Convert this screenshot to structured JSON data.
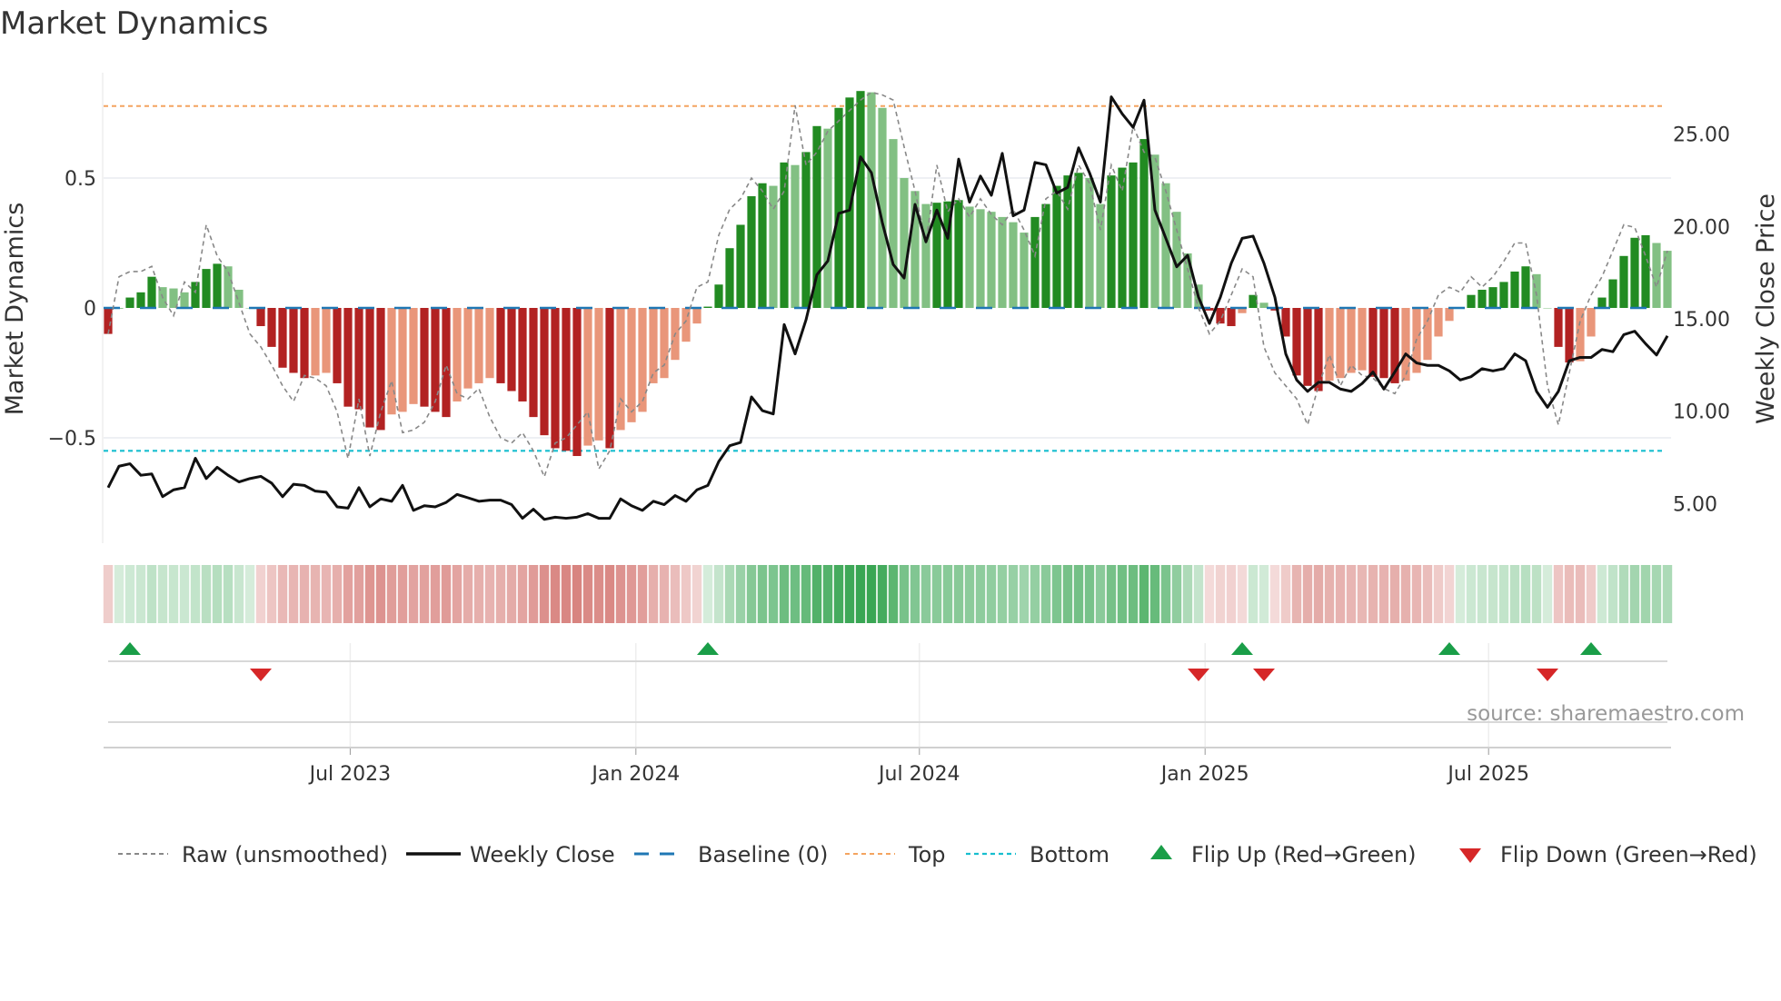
{
  "title": "Market Dynamics",
  "source": "source: sharemaestro.com",
  "colors": {
    "green_strong": "#228b22",
    "green_light": "#82c083",
    "red_strong": "#b22222",
    "red_light": "#e9967a",
    "close": "#111111",
    "raw": "#888888",
    "baseline": "#1f77b4",
    "top": "#f4a460",
    "bottom": "#17becf",
    "flip_up": "#1a9e48",
    "flip_down": "#d62728"
  },
  "chart_data": {
    "type": "bar",
    "title": "Market Dynamics",
    "ylabel": "Market Dynamics",
    "y2label": "Weekly Close Price",
    "ylim": [
      -0.93,
      0.9
    ],
    "y2lim": [
      1.5,
      28.5
    ],
    "yticks": [
      {
        "v": 0.5,
        "label": "0.5"
      },
      {
        "v": 0,
        "label": "0"
      },
      {
        "v": -0.5,
        "label": "−0.5"
      }
    ],
    "y2ticks": [
      {
        "v": 25,
        "label": "25.00"
      },
      {
        "v": 20,
        "label": "20.00"
      },
      {
        "v": 15,
        "label": "15.00"
      },
      {
        "v": 10,
        "label": "10.00"
      },
      {
        "v": 5,
        "label": "5.00"
      }
    ],
    "xticks": [
      {
        "i": 22.2,
        "label": "Jul 2023"
      },
      {
        "i": 48.4,
        "label": "Jan 2024"
      },
      {
        "i": 74.4,
        "label": "Jul 2024"
      },
      {
        "i": 100.6,
        "label": "Jan 2025"
      },
      {
        "i": 126.6,
        "label": "Jul 2025"
      }
    ],
    "top_level": 0.777,
    "bottom_level": -0.55,
    "momentum": [
      -0.1,
      0,
      0.04,
      0.06,
      0.12,
      0.08,
      0.075,
      0.06,
      0.1,
      0.15,
      0.17,
      0.16,
      0.07,
      0,
      -0.07,
      -0.15,
      -0.23,
      -0.25,
      -0.27,
      -0.26,
      -0.25,
      -0.29,
      -0.38,
      -0.39,
      -0.46,
      -0.47,
      -0.41,
      -0.4,
      -0.37,
      -0.38,
      -0.4,
      -0.42,
      -0.36,
      -0.31,
      -0.29,
      -0.27,
      -0.29,
      -0.32,
      -0.36,
      -0.42,
      -0.49,
      -0.54,
      -0.55,
      -0.57,
      -0.53,
      -0.51,
      -0.54,
      -0.47,
      -0.44,
      -0.4,
      -0.29,
      -0.27,
      -0.2,
      -0.13,
      -0.06,
      0.005,
      0.09,
      0.23,
      0.32,
      0.43,
      0.48,
      0.47,
      0.56,
      0.55,
      0.6,
      0.7,
      0.69,
      0.77,
      0.81,
      0.835,
      0.83,
      0.77,
      0.65,
      0.5,
      0.45,
      0.4,
      0.405,
      0.41,
      0.415,
      0.39,
      0.38,
      0.37,
      0.35,
      0.33,
      0.29,
      0.35,
      0.4,
      0.47,
      0.51,
      0.52,
      0.5,
      0.4,
      0.51,
      0.54,
      0.56,
      0.65,
      0.59,
      0.48,
      0.37,
      0.21,
      0.09,
      -0.01,
      -0.06,
      -0.07,
      -0.02,
      0.05,
      0.02,
      -0.01,
      -0.11,
      -0.26,
      -0.3,
      -0.32,
      -0.28,
      -0.27,
      -0.25,
      -0.24,
      -0.265,
      -0.27,
      -0.29,
      -0.28,
      -0.25,
      -0.2,
      -0.11,
      -0.05,
      0,
      0.05,
      0.07,
      0.08,
      0.1,
      0.14,
      0.16,
      0.13,
      0,
      -0.15,
      -0.21,
      -0.205,
      -0.11,
      0.04,
      0.11,
      0.2,
      0.27,
      0.28,
      0.25,
      0.22
    ],
    "raw": [
      -0.1,
      0.12,
      0.14,
      0.14,
      0.16,
      0.04,
      -0.03,
      0.1,
      0.06,
      0.32,
      0.2,
      0.14,
      0.02,
      -0.1,
      -0.15,
      -0.22,
      -0.3,
      -0.36,
      -0.26,
      -0.27,
      -0.3,
      -0.4,
      -0.58,
      -0.35,
      -0.57,
      -0.4,
      -0.28,
      -0.48,
      -0.47,
      -0.44,
      -0.36,
      -0.22,
      -0.33,
      -0.35,
      -0.31,
      -0.42,
      -0.5,
      -0.52,
      -0.48,
      -0.55,
      -0.65,
      -0.52,
      -0.5,
      -0.45,
      -0.4,
      -0.62,
      -0.55,
      -0.35,
      -0.4,
      -0.36,
      -0.25,
      -0.22,
      -0.1,
      -0.05,
      0.08,
      0.1,
      0.28,
      0.38,
      0.42,
      0.5,
      0.45,
      0.38,
      0.45,
      0.78,
      0.55,
      0.6,
      0.68,
      0.72,
      0.76,
      0.8,
      0.83,
      0.82,
      0.8,
      0.62,
      0.45,
      0.25,
      0.55,
      0.37,
      0.42,
      0.35,
      0.42,
      0.36,
      0.32,
      0.38,
      0.3,
      0.2,
      0.42,
      0.45,
      0.38,
      0.55,
      0.48,
      0.3,
      0.55,
      0.45,
      0.7,
      0.6,
      0.58,
      0.45,
      0.3,
      0.15,
      0.0,
      -0.1,
      -0.05,
      0.05,
      0.15,
      0.12,
      -0.15,
      -0.25,
      -0.3,
      -0.35,
      -0.45,
      -0.3,
      -0.18,
      -0.3,
      -0.22,
      -0.26,
      -0.27,
      -0.31,
      -0.33,
      -0.26,
      -0.12,
      -0.05,
      0.05,
      0.08,
      0.06,
      0.12,
      0.08,
      0.12,
      0.18,
      0.25,
      0.25,
      0.05,
      -0.3,
      -0.45,
      -0.25,
      -0.05,
      0.05,
      0.12,
      0.22,
      0.32,
      0.31,
      0.2,
      0.08,
      0.22
    ],
    "close": [
      5.86,
      7.02,
      7.15,
      6.53,
      6.6,
      5.37,
      5.74,
      5.86,
      7.45,
      6.35,
      6.96,
      6.53,
      6.17,
      6.35,
      6.47,
      6.1,
      5.37,
      6.04,
      5.98,
      5.67,
      5.61,
      4.82,
      4.75,
      5.86,
      4.82,
      5.25,
      5.12,
      5.98,
      4.63,
      4.88,
      4.82,
      5.06,
      5.49,
      5.31,
      5.12,
      5.18,
      5.18,
      4.94,
      4.2,
      4.69,
      4.14,
      4.26,
      4.2,
      4.26,
      4.45,
      4.2,
      4.2,
      5.25,
      4.88,
      4.63,
      5.12,
      4.94,
      5.43,
      5.12,
      5.74,
      5.98,
      7.27,
      8.13,
      8.31,
      10.77,
      10.03,
      9.85,
      14.69,
      13.1,
      14.94,
      17.39,
      18.13,
      20.71,
      20.89,
      23.77,
      22.91,
      20.21,
      17.94,
      17.21,
      21.2,
      19.17,
      20.89,
      19.36,
      23.65,
      21.32,
      22.73,
      21.69,
      23.96,
      20.58,
      20.89,
      23.47,
      23.34,
      21.81,
      22.12,
      24.26,
      22.91,
      21.32,
      27.02,
      26.1,
      25.37,
      26.84,
      20.89,
      19.36,
      17.82,
      18.44,
      16.17,
      14.75,
      16.17,
      18.01,
      19.36,
      19.48,
      18.01,
      16.17,
      13.1,
      11.69,
      11.07,
      11.56,
      11.56,
      11.2,
      11.07,
      11.5,
      12.12,
      11.2,
      12.12,
      13.1,
      12.61,
      12.48,
      12.48,
      12.18,
      11.69,
      11.87,
      12.3,
      12.18,
      12.3,
      13.1,
      12.73,
      11.07,
      10.21,
      11.07,
      12.73,
      12.91,
      12.91,
      13.34,
      13.22,
      14.14,
      14.33,
      13.65,
      13.04,
      14.08
    ],
    "flip_up_index": [
      2,
      55,
      104,
      123,
      136
    ],
    "flip_down_index": [
      14,
      100,
      106,
      132
    ],
    "legend": {
      "position": "bottom",
      "items": [
        {
          "key": "raw",
          "label": "Raw (unsmoothed)"
        },
        {
          "key": "close",
          "label": "Weekly Close"
        },
        {
          "key": "baseline",
          "label": "Baseline (0)"
        },
        {
          "key": "top",
          "label": "Top"
        },
        {
          "key": "bottom",
          "label": "Bottom"
        },
        {
          "key": "flip_up",
          "label": "Flip Up (Red→Green)"
        },
        {
          "key": "flip_down",
          "label": "Flip Down (Green→Red)"
        }
      ]
    }
  }
}
